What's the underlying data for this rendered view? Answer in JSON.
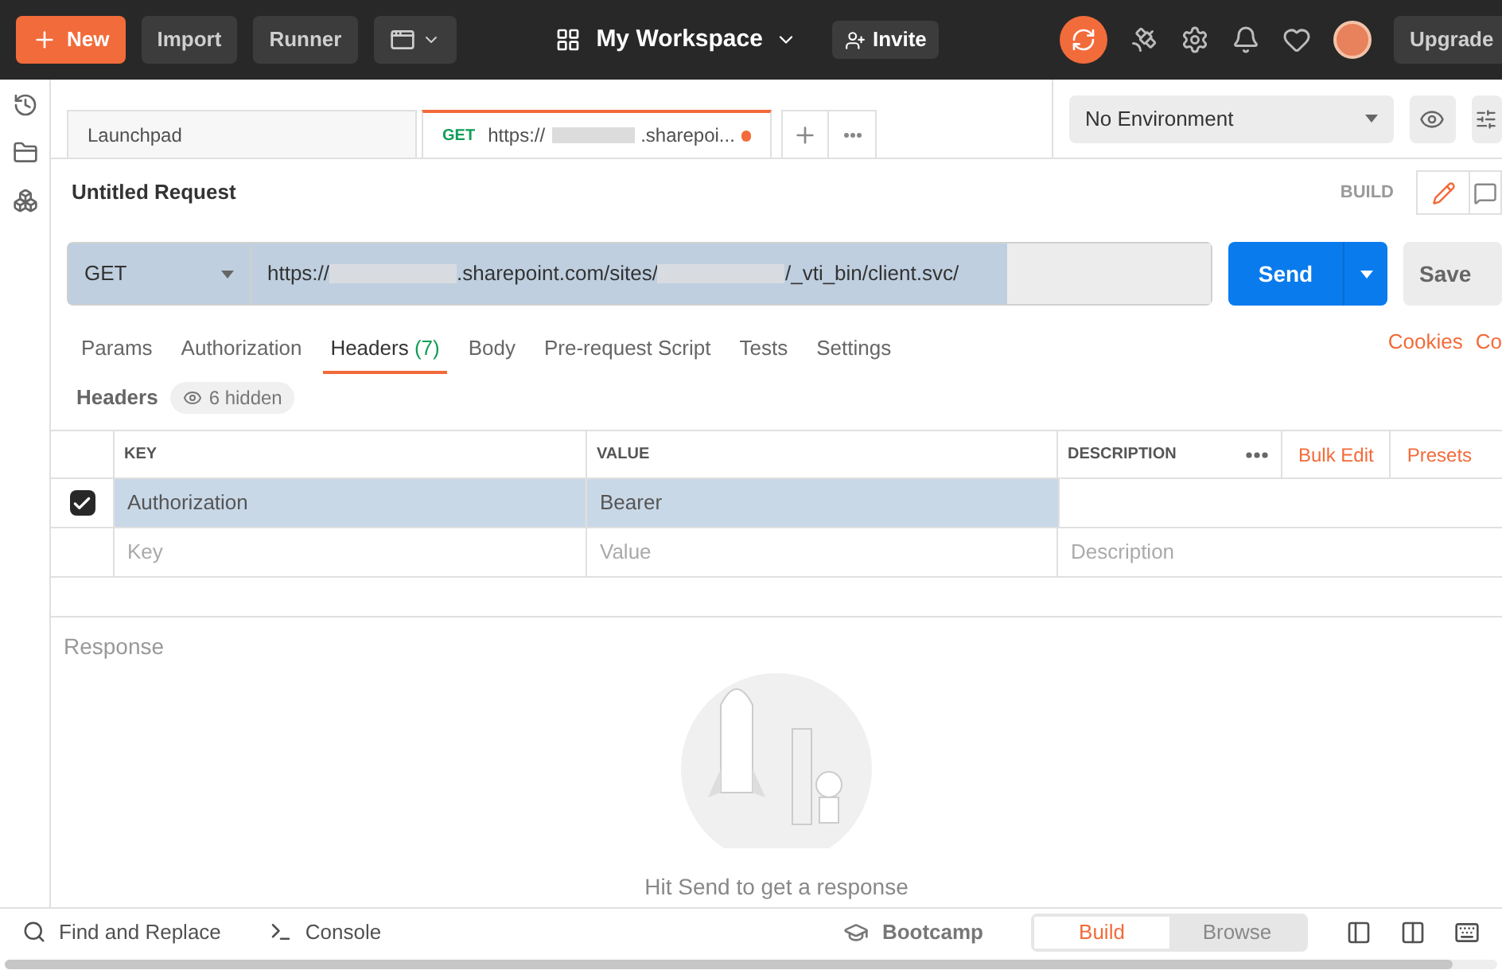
{
  "topbar": {
    "new": "New",
    "import": "Import",
    "runner": "Runner",
    "workspace": "My Workspace",
    "invite": "Invite",
    "upgrade": "Upgrade"
  },
  "tabs": [
    {
      "label": "Launchpad",
      "selected": false,
      "modified": false
    },
    {
      "method": "GET",
      "label": "https://",
      "label_end": ".sharepoi...",
      "selected": true,
      "modified": true
    }
  ],
  "environment": {
    "value": "No Environment"
  },
  "request": {
    "title": "Untitled Request",
    "mode": "BUILD",
    "method": "GET",
    "url": [
      {
        "kind": "text",
        "text": "https://"
      },
      {
        "kind": "redacted"
      },
      {
        "kind": "text",
        "text": ".sharepoint.com/sites/"
      },
      {
        "kind": "redacted"
      },
      {
        "kind": "text",
        "text": "/_vti_bin/client.svc/"
      }
    ],
    "send": "Send",
    "save": "Save"
  },
  "request_tabs": [
    {
      "label": "Params",
      "selected": false
    },
    {
      "label": "Authorization",
      "selected": false
    },
    {
      "label": "Headers",
      "count": "(7)",
      "selected": true
    },
    {
      "label": "Body",
      "selected": false
    },
    {
      "label": "Pre-request Script",
      "selected": false
    },
    {
      "label": "Tests",
      "selected": false
    },
    {
      "label": "Settings",
      "selected": false
    }
  ],
  "links": [
    "Cookies",
    "Co"
  ],
  "headers": {
    "title": "Headers",
    "hidden": "6 hidden",
    "columns": [
      "KEY",
      "VALUE",
      "DESCRIPTION"
    ],
    "bulk_edit": "Bulk Edit",
    "presets": "Presets",
    "rows": [
      {
        "checked": true,
        "key": "Authorization",
        "value": "Bearer"
      }
    ],
    "new_row": {
      "key_placeholder": "Key",
      "value_placeholder": "Value",
      "description_placeholder": "Description"
    }
  },
  "response": {
    "title": "Response",
    "hint": "Hit Send to get a response"
  },
  "status_bar": {
    "find": "Find and Replace",
    "console": "Console",
    "bootcamp": "Bootcamp",
    "modes": [
      {
        "label": "Build",
        "selected": true
      },
      {
        "label": "Browse",
        "selected": false
      }
    ]
  }
}
